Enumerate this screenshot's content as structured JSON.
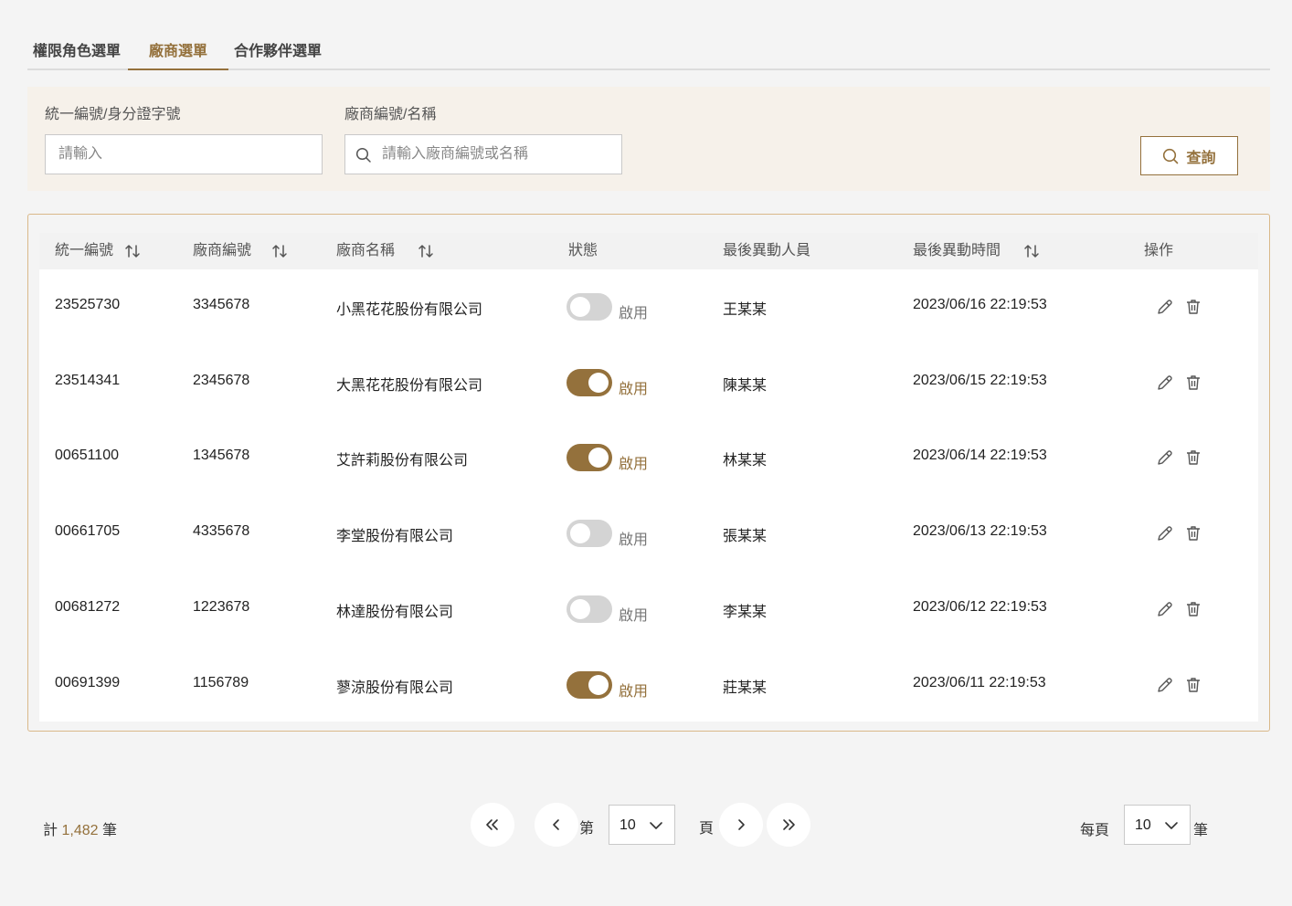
{
  "tabs": [
    {
      "label": "權限角色選單"
    },
    {
      "label": "廠商選單"
    },
    {
      "label": "合作夥伴選單"
    }
  ],
  "filter": {
    "tax_id_label": "統一編號/身分證字號",
    "tax_id_placeholder": "請輸入",
    "vendor_label": "廠商編號/名稱",
    "vendor_placeholder": "請輸入廠商編號或名稱",
    "query_label": "查詢"
  },
  "table": {
    "headers": {
      "tax_id": "統一編號",
      "vendor_no": "廠商編號",
      "vendor_name": "廠商名稱",
      "status": "狀態",
      "last_modifier": "最後異動人員",
      "last_modified": "最後異動時間",
      "actions": "操作"
    },
    "rows": [
      {
        "tax_id": "23525730",
        "vendor_no": "3345678",
        "vendor_name": "小黑花花股份有限公司",
        "enabled": false,
        "status_label": "啟用",
        "modifier": "王某某",
        "time": "2023/06/16 22:19:53"
      },
      {
        "tax_id": "23514341",
        "vendor_no": "2345678",
        "vendor_name": "大黑花花股份有限公司",
        "enabled": true,
        "status_label": "啟用",
        "modifier": "陳某某",
        "time": "2023/06/15 22:19:53"
      },
      {
        "tax_id": "00651100",
        "vendor_no": "1345678",
        "vendor_name": "艾許莉股份有限公司",
        "enabled": true,
        "status_label": "啟用",
        "modifier": "林某某",
        "time": "2023/06/14 22:19:53"
      },
      {
        "tax_id": "00661705",
        "vendor_no": "4335678",
        "vendor_name": "李堂股份有限公司",
        "enabled": false,
        "status_label": "啟用",
        "modifier": "張某某",
        "time": "2023/06/13 22:19:53"
      },
      {
        "tax_id": "00681272",
        "vendor_no": "1223678",
        "vendor_name": "林達股份有限公司",
        "enabled": false,
        "status_label": "啟用",
        "modifier": "李某某",
        "time": "2023/06/12 22:19:53"
      },
      {
        "tax_id": "00691399",
        "vendor_no": "1156789",
        "vendor_name": "蓼涼股份有限公司",
        "enabled": true,
        "status_label": "啟用",
        "modifier": "莊某某",
        "time": "2023/06/11 22:19:53"
      }
    ]
  },
  "pagination": {
    "total_prefix": "計",
    "total_count": "1,482",
    "total_suffix": "筆",
    "page_prefix": "第",
    "page_value": "10",
    "page_suffix": "頁",
    "per_page_prefix": "每頁",
    "per_page_value": "10",
    "per_page_suffix": "筆"
  },
  "icons": {
    "search": "search-icon",
    "sort": "sort-icon",
    "edit": "pencil-icon",
    "delete": "trash-icon",
    "first": "double-chevron-left-icon",
    "prev": "chevron-left-icon",
    "next": "chevron-right-icon",
    "last": "double-chevron-right-icon",
    "dropdown": "chevron-down-icon"
  },
  "colors": {
    "accent": "#94713c",
    "filter_bg": "#f6f1ea",
    "card_border": "#d9b889",
    "toggle_off": "#d4d4d4"
  }
}
